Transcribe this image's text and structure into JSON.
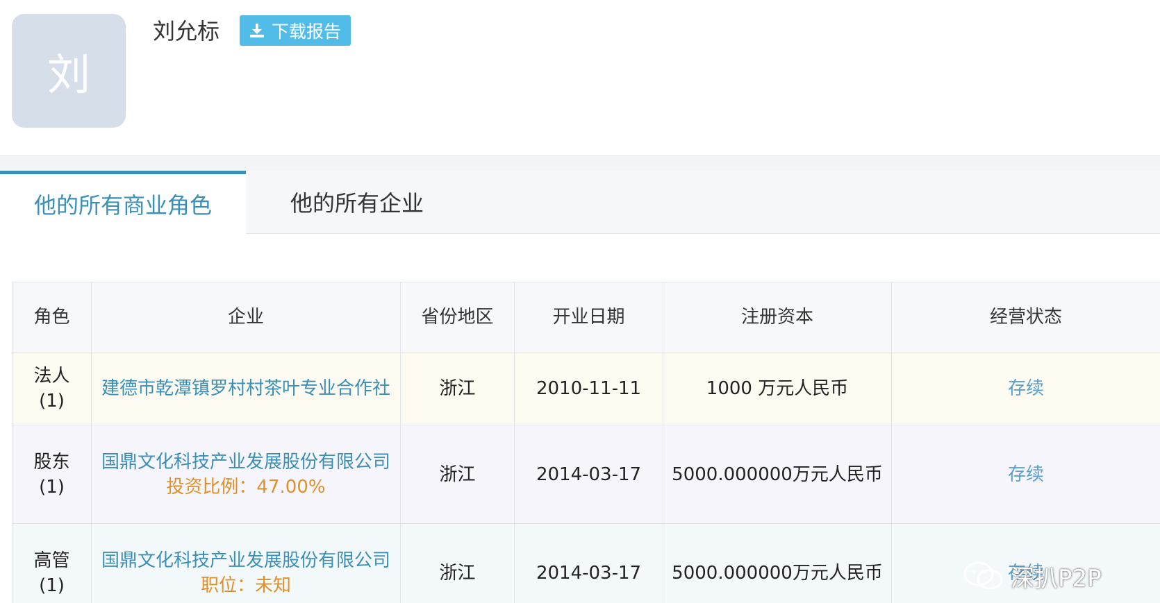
{
  "profile": {
    "avatar_char": "刘",
    "name": "刘允标",
    "download_label": "下载报告"
  },
  "tabs": [
    {
      "label": "他的所有商业角色",
      "active": true
    },
    {
      "label": "他的所有企业",
      "active": false
    }
  ],
  "table": {
    "headers": [
      "角色",
      "企业",
      "省份地区",
      "开业日期",
      "注册资本",
      "经营状态"
    ],
    "rows": [
      {
        "role": "法人",
        "role_count": "(1)",
        "company": "建德市乾潭镇罗村村茶叶专业合作社",
        "extra": "",
        "province": "浙江",
        "date": "2010-11-11",
        "capital": "1000 万元人民币",
        "status": "存续"
      },
      {
        "role": "股东",
        "role_count": "(1)",
        "company": "国鼎文化科技产业发展股份有限公司",
        "extra": "投资比例：47.00%",
        "province": "浙江",
        "date": "2014-03-17",
        "capital": "5000.000000万元人民币",
        "status": "存续"
      },
      {
        "role": "高管",
        "role_count": "(1)",
        "company": "国鼎文化科技产业发展股份有限公司",
        "extra": "职位：未知",
        "province": "浙江",
        "date": "2014-03-17",
        "capital": "5000.000000万元人民币",
        "status": "存续"
      }
    ]
  },
  "watermark": {
    "text": "深扒P2P",
    "icon": "wechat-icon"
  },
  "colors": {
    "accent": "#3a8fb7",
    "button": "#52bce8",
    "extra_text": "#e0902a",
    "avatar_bg": "#d5dee9"
  }
}
